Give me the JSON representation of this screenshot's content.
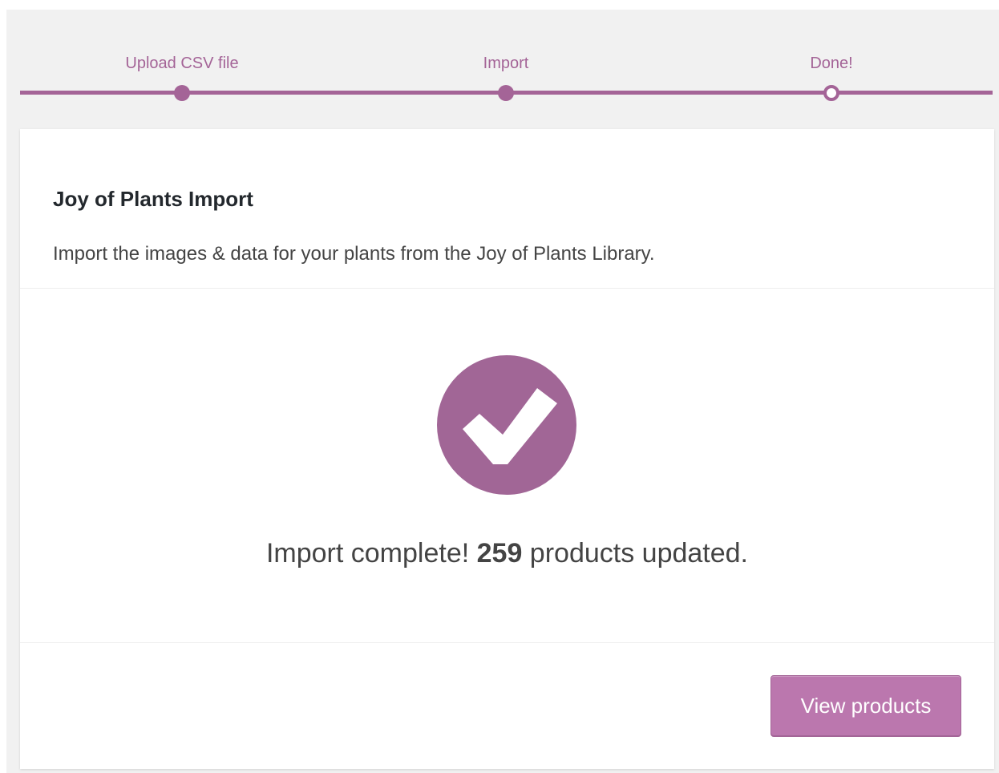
{
  "steps": [
    {
      "label": "Upload CSV file",
      "state": "done"
    },
    {
      "label": "Import",
      "state": "done"
    },
    {
      "label": "Done!",
      "state": "current"
    }
  ],
  "card": {
    "title": "Joy of Plants Import",
    "description": "Import the images & data for your plants from the Joy of Plants Library."
  },
  "result": {
    "icon": "checkmark-icon",
    "prefix": "Import complete! ",
    "count": "259",
    "suffix": " products updated."
  },
  "footer": {
    "button_label": "View products"
  },
  "colors": {
    "accent": "#a46497",
    "button": "#bb77ae",
    "check_circle": "#a16696"
  }
}
